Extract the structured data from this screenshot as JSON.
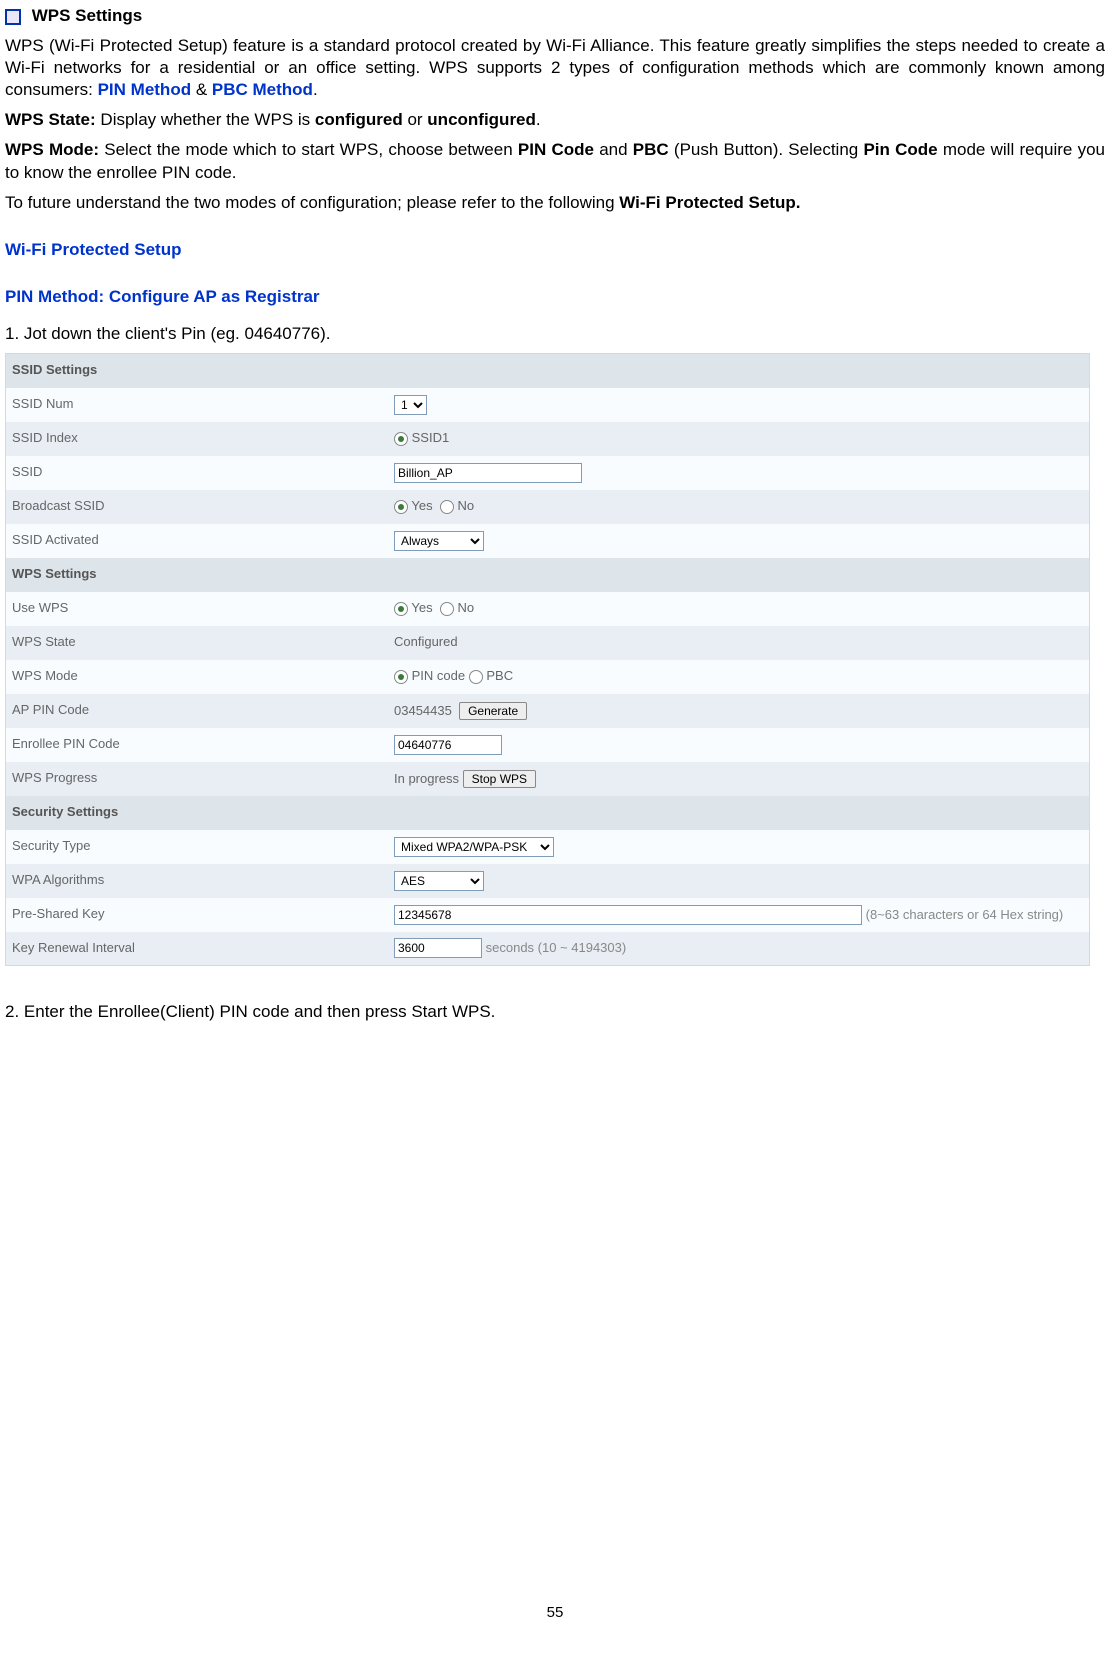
{
  "header": {
    "title": "WPS Settings"
  },
  "intro": {
    "p1_a": "WPS (Wi-Fi Protected Setup) feature is a standard protocol created by Wi-Fi Alliance. This feature greatly simplifies the steps needed to create a Wi-Fi networks for a residential or an office setting. WPS supports 2 types of configuration methods which are commonly known among consumers: ",
    "pin_method": "PIN Method",
    "amp": " & ",
    "pbc_method": "PBC Method",
    "dot": ".",
    "state_label": "WPS State:",
    "state_text_a": " Display whether the WPS is ",
    "state_conf": "configured",
    "state_or": " or ",
    "state_unconf": "unconfigured",
    "mode_label": "WPS Mode:",
    "mode_text_a": " Select the mode which to start WPS, choose between ",
    "mode_pin": "PIN Code",
    "mode_and": " and ",
    "mode_pbc": "PBC",
    "mode_text_b": " (Push Button). Selecting ",
    "mode_pincode": "Pin Code",
    "mode_text_c": " mode will require you to know the enrollee PIN code.",
    "future_a": "To future understand the two modes of configuration; please refer to the following ",
    "future_b": "Wi-Fi Protected Setup."
  },
  "sections": {
    "wifi_protected": "Wi-Fi Protected Setup",
    "pin_registrar": "PIN Method: Configure AP as Registrar",
    "step1": "1. Jot down the client's Pin (eg. 04640776).",
    "step2": "2.  Enter the Enrollee(Client) PIN code and then press Start WPS."
  },
  "table": {
    "h_ssid_settings": "SSID Settings",
    "ssid_num": {
      "label": "SSID Num",
      "value": "1"
    },
    "ssid_index": {
      "label": "SSID Index",
      "value": "SSID1"
    },
    "ssid": {
      "label": "SSID",
      "value": "Billion_AP"
    },
    "broadcast": {
      "label": "Broadcast SSID",
      "yes": "Yes",
      "no": "No"
    },
    "activated": {
      "label": "SSID Activated",
      "value": "Always"
    },
    "h_wps_settings": "WPS Settings",
    "use_wps": {
      "label": "Use WPS",
      "yes": "Yes",
      "no": "No"
    },
    "wps_state": {
      "label": "WPS State",
      "value": "Configured"
    },
    "wps_mode": {
      "label": "WPS Mode",
      "pin": "PIN code",
      "pbc": "PBC"
    },
    "ap_pin": {
      "label": "AP PIN Code",
      "value": "03454435",
      "btn": "Generate"
    },
    "enrollee": {
      "label": "Enrollee PIN Code",
      "value": "04640776"
    },
    "progress": {
      "label": "WPS Progress",
      "value": "In progress",
      "btn": "Stop WPS"
    },
    "h_security": "Security Settings",
    "sec_type": {
      "label": "Security Type",
      "value": "Mixed WPA2/WPA-PSK"
    },
    "wpa_alg": {
      "label": "WPA Algorithms",
      "value": "AES"
    },
    "psk": {
      "label": "Pre-Shared Key",
      "value": "12345678",
      "hint": "(8~63 characters or 64 Hex string)"
    },
    "renewal": {
      "label": "Key Renewal Interval",
      "value": "3600",
      "hint": "seconds   (10 ~ 4194303)"
    }
  },
  "page": "55"
}
